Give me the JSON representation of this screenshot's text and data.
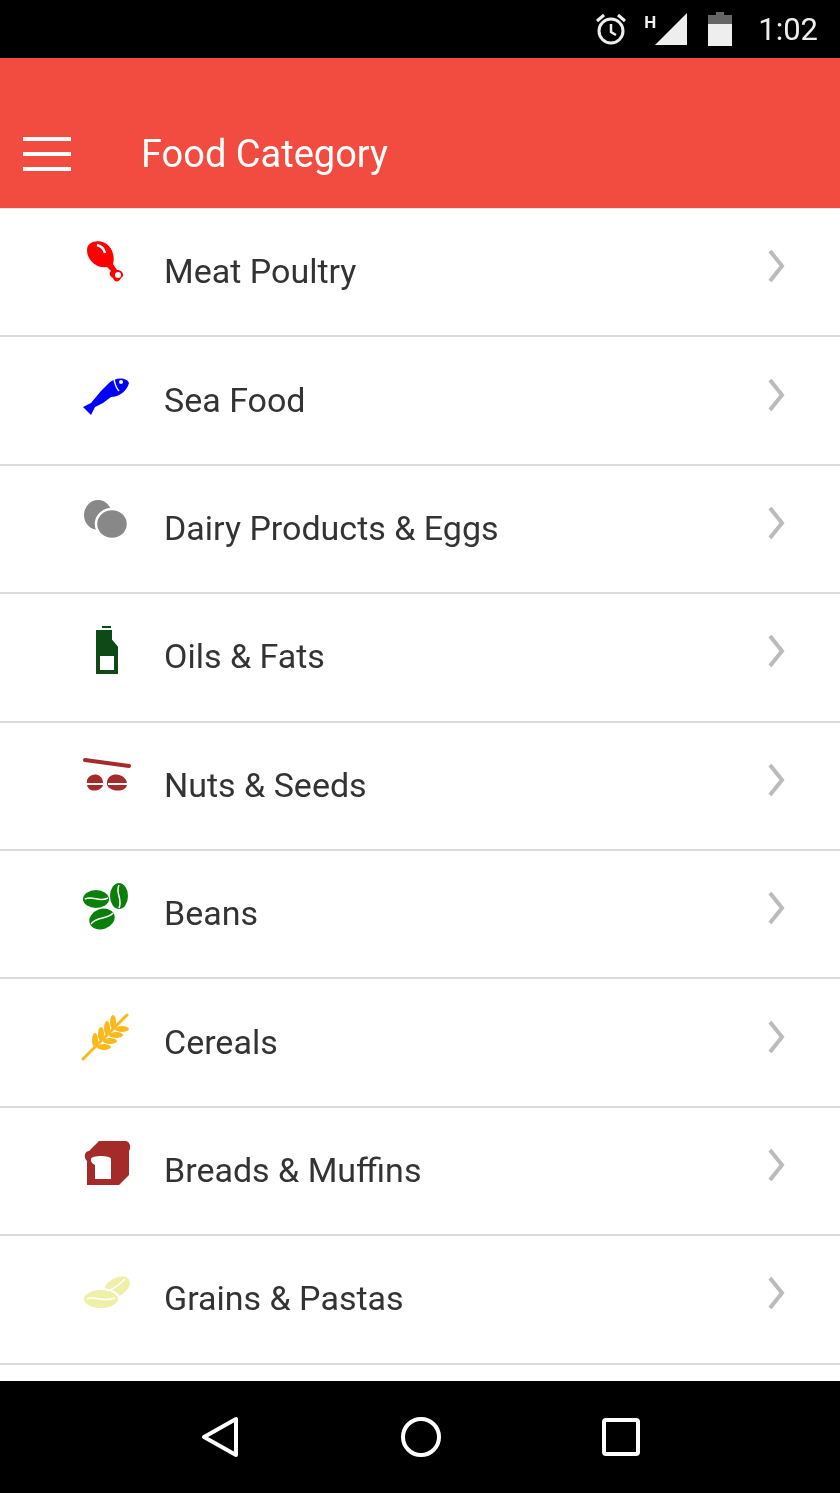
{
  "status_bar": {
    "network": "H",
    "time": "1:02"
  },
  "app_bar": {
    "title": "Food Category"
  },
  "categories": [
    {
      "label": "Meat Poultry",
      "kind": "drumstick"
    },
    {
      "label": "Sea Food",
      "kind": "fish"
    },
    {
      "label": "Dairy Products & Eggs",
      "kind": "eggs"
    },
    {
      "label": "Oils & Fats",
      "kind": "bottle"
    },
    {
      "label": "Nuts & Seeds",
      "kind": "nuts"
    },
    {
      "label": "Beans",
      "kind": "beans"
    },
    {
      "label": "Cereals",
      "kind": "wheat"
    },
    {
      "label": "Breads & Muffins",
      "kind": "bread"
    },
    {
      "label": "Grains & Pastas",
      "kind": "grains"
    }
  ]
}
